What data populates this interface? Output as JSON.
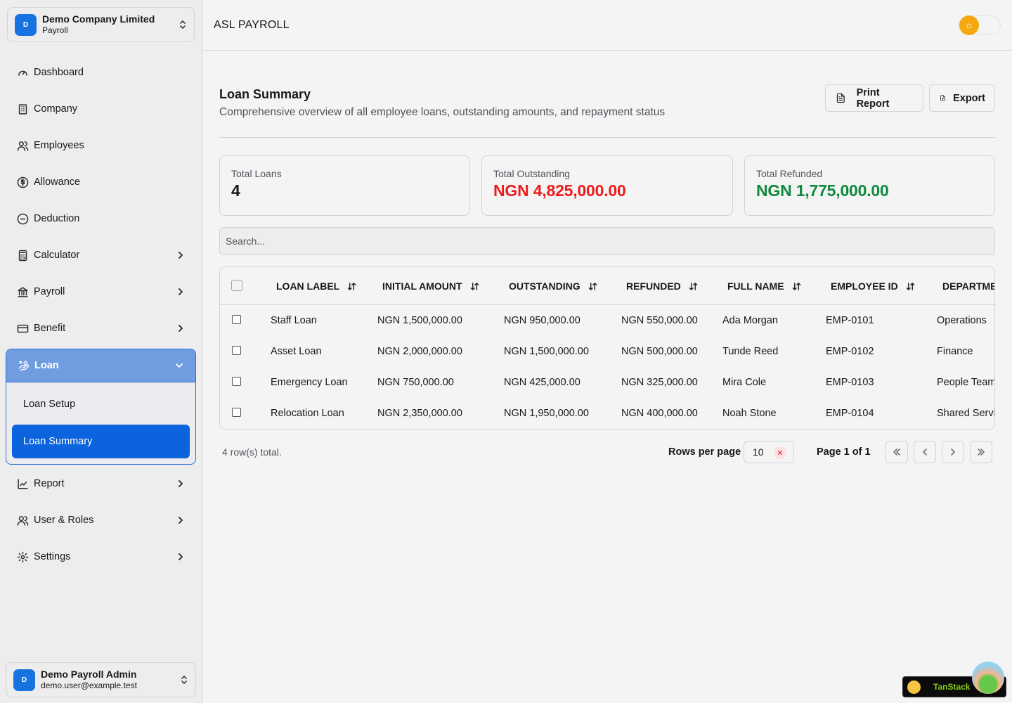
{
  "org": {
    "avatar": "D",
    "name": "Demo Company Limited",
    "module": "Payroll"
  },
  "nav_items_top": [
    {
      "label": "Dashboard",
      "icon": "gauge-icon"
    },
    {
      "label": "Company",
      "icon": "building-icon"
    },
    {
      "label": "Employees",
      "icon": "users-icon"
    },
    {
      "label": "Allowance",
      "icon": "dollar-circle-icon"
    },
    {
      "label": "Deduction",
      "icon": "minus-circle-icon"
    },
    {
      "label": "Calculator",
      "icon": "calculator-icon",
      "has_children": true
    },
    {
      "label": "Payroll",
      "icon": "bank-icon",
      "has_children": true
    },
    {
      "label": "Benefit",
      "icon": "card-icon",
      "has_children": true
    }
  ],
  "loan_group": {
    "label": "Loan",
    "icon": "hand-coins-icon",
    "children": [
      "Loan Setup",
      "Loan Summary"
    ],
    "active_child": "Loan Summary"
  },
  "nav_items_bottom": [
    {
      "label": "Report",
      "icon": "chart-icon",
      "has_children": true
    },
    {
      "label": "User & Roles",
      "icon": "users-icon",
      "has_children": true
    },
    {
      "label": "Settings",
      "icon": "gear-icon",
      "has_children": true
    }
  ],
  "user": {
    "avatar": "D",
    "name": "Demo Payroll Admin",
    "email": "demo.user@example.test"
  },
  "topbar": {
    "title": "ASL PAYROLL",
    "theme": "light"
  },
  "page": {
    "title": "Loan Summary",
    "subtitle": "Comprehensive overview of all employee loans, outstanding amounts, and repayment status",
    "print_label": "Print Report",
    "export_label": "Export"
  },
  "stats": [
    {
      "label": "Total Loans",
      "value": "4",
      "color": "#18181b"
    },
    {
      "label": "Total Outstanding",
      "value": "NGN 4,825,000.00",
      "color": "#ec1c1c"
    },
    {
      "label": "Total Refunded",
      "value": "NGN 1,775,000.00",
      "color": "#0f8a3c"
    }
  ],
  "search": {
    "placeholder": "Search..."
  },
  "table": {
    "columns": [
      "LOAN LABEL",
      "INITIAL AMOUNT",
      "OUTSTANDING",
      "REFUNDED",
      "FULL NAME",
      "EMPLOYEE ID",
      "DEPARTME"
    ],
    "rows": [
      [
        "Staff Loan",
        "NGN 1,500,000.00",
        "NGN 950,000.00",
        "NGN 550,000.00",
        "Ada Morgan",
        "EMP-0101",
        "Operations"
      ],
      [
        "Asset Loan",
        "NGN 2,000,000.00",
        "NGN 1,500,000.00",
        "NGN 500,000.00",
        "Tunde Reed",
        "EMP-0102",
        "Finance"
      ],
      [
        "Emergency Loan",
        "NGN 750,000.00",
        "NGN 425,000.00",
        "NGN 325,000.00",
        "Mira Cole",
        "EMP-0103",
        "People Team"
      ],
      [
        "Relocation Loan",
        "NGN 2,350,000.00",
        "NGN 1,950,000.00",
        "NGN 400,000.00",
        "Noah Stone",
        "EMP-0104",
        "Shared Servi"
      ]
    ]
  },
  "pagination": {
    "rows_total": "4 row(s) total.",
    "rows_per_page_label": "Rows per page",
    "rows_per_page": "10",
    "page_info": "Page 1 of 1"
  },
  "devtools": {
    "label": "TanStack"
  }
}
